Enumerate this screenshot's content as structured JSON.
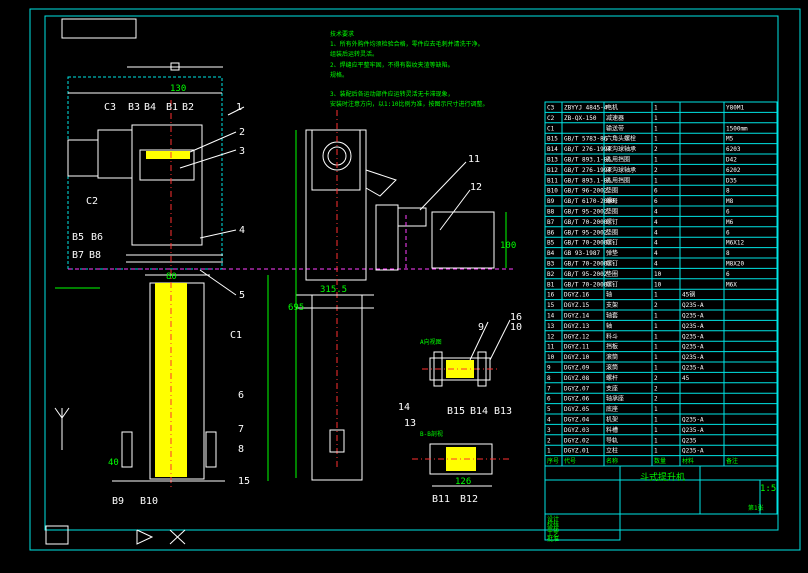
{
  "drawing": {
    "callouts_right": [
      "1",
      "2",
      "3",
      "4",
      "5"
    ],
    "callouts_c": [
      "C3",
      "B3",
      "B4",
      "B1",
      "B2",
      "C2",
      "B5",
      "B6",
      "B7",
      "B8",
      "C1"
    ],
    "callouts_bottom_left": [
      "6",
      "7",
      "8",
      "15",
      "B9",
      "B10"
    ],
    "callouts_mid": [
      "11",
      "12"
    ],
    "callouts_detail": [
      "16",
      "9",
      "10",
      "14",
      "B15",
      "B14",
      "B13",
      "13",
      "B11",
      "B12"
    ],
    "dims": {
      "d130": "130",
      "d80": "80",
      "d40": "40",
      "d100": "100",
      "d315": "315.5",
      "d126": "126",
      "d695": "695"
    },
    "colors": {
      "bg": "#000000",
      "frame": "#00e5e5",
      "line": "#ffffff",
      "text": "#00ff00",
      "center": "#ff3030",
      "fill": "#ffff00",
      "hidden": "#ff40ff"
    }
  },
  "notes": {
    "title": "技术要求",
    "lines": [
      "1、所有外购件均须检验合格，零件应去毛刺并清洗干净。",
      "组装后运转灵活。",
      "2、焊缝应平整牢固，不得有裂纹夹渣等缺陷。",
      "规格。",
      "3、装配后各运动部件应运转灵活无卡滞现象，",
      "安装时注意方向，以1:10比例为准，按图示尺寸进行调整。"
    ]
  },
  "bom": {
    "rows": [
      {
        "no": "C3",
        "code": "ZBYYJ 4845-4",
        "name": "电机",
        "qty": "1",
        "mat": "",
        "note": "Y80M1"
      },
      {
        "no": "C2",
        "code": "ZB-QX-150",
        "name": "减速器",
        "qty": "1",
        "mat": "",
        "note": ""
      },
      {
        "no": "C1",
        "code": "",
        "name": "输送带",
        "qty": "1",
        "mat": "",
        "note": "1500mm"
      },
      {
        "no": "B15",
        "code": "GB/T 5783-86",
        "name": "六角头螺栓",
        "qty": "1",
        "mat": "",
        "note": "M5"
      },
      {
        "no": "B14",
        "code": "GB/T 276-1994",
        "name": "深沟球轴承",
        "qty": "2",
        "mat": "",
        "note": "6203"
      },
      {
        "no": "B13",
        "code": "GB/T 893.1-86",
        "name": "孔用挡圈",
        "qty": "1",
        "mat": "",
        "note": "D42"
      },
      {
        "no": "B12",
        "code": "GB/T 276-1994",
        "name": "深沟球轴承",
        "qty": "2",
        "mat": "",
        "note": "6202"
      },
      {
        "no": "B11",
        "code": "GB/T 893.1-86",
        "name": "孔用挡圈",
        "qty": "1",
        "mat": "",
        "note": "D35"
      },
      {
        "no": "B10",
        "code": "GB/T 96-2002",
        "name": "垫圈",
        "qty": "6",
        "mat": "",
        "note": "8"
      },
      {
        "no": "B9",
        "code": "GB/T 6170-2000",
        "name": "螺母",
        "qty": "6",
        "mat": "",
        "note": "M8"
      },
      {
        "no": "B8",
        "code": "GB/T 95-2002",
        "name": "垫圈",
        "qty": "4",
        "mat": "",
        "note": "6"
      },
      {
        "no": "B7",
        "code": "GB/T 70-2000",
        "name": "螺钉",
        "qty": "4",
        "mat": "",
        "note": "M6"
      },
      {
        "no": "B6",
        "code": "GB/T 95-2002",
        "name": "垫圈",
        "qty": "4",
        "mat": "",
        "note": "6"
      },
      {
        "no": "B5",
        "code": "GB/T 70-2000",
        "name": "螺钉",
        "qty": "4",
        "mat": "",
        "note": "M6X12"
      },
      {
        "no": "B4",
        "code": "GB 93-1987",
        "name": "弹垫",
        "qty": "4",
        "mat": "",
        "note": "8"
      },
      {
        "no": "B3",
        "code": "GB/T 70-2000",
        "name": "螺钉",
        "qty": "4",
        "mat": "",
        "note": "M8X20"
      },
      {
        "no": "B2",
        "code": "GB/T 95-2002",
        "name": "垫圈",
        "qty": "10",
        "mat": "",
        "note": "6"
      },
      {
        "no": "B1",
        "code": "GB/T 70-2000",
        "name": "螺钉",
        "qty": "10",
        "mat": "",
        "note": "M6X"
      },
      {
        "no": "16",
        "code": "DGYZ.16",
        "name": "轴",
        "qty": "1",
        "mat": "45钢",
        "note": ""
      },
      {
        "no": "15",
        "code": "DGYZ.15",
        "name": "支架",
        "qty": "2",
        "mat": "Q235-A",
        "note": ""
      },
      {
        "no": "14",
        "code": "DGYZ.14",
        "name": "轴套",
        "qty": "1",
        "mat": "Q235-A",
        "note": ""
      },
      {
        "no": "13",
        "code": "DGYZ.13",
        "name": "轴",
        "qty": "1",
        "mat": "Q235-A",
        "note": ""
      },
      {
        "no": "12",
        "code": "DGYZ.12",
        "name": "料斗",
        "qty": "1",
        "mat": "Q235-A",
        "note": ""
      },
      {
        "no": "11",
        "code": "DGYZ.11",
        "name": "挡板",
        "qty": "1",
        "mat": "Q235-A",
        "note": ""
      },
      {
        "no": "10",
        "code": "DGYZ.10",
        "name": "滚筒",
        "qty": "1",
        "mat": "Q235-A",
        "note": ""
      },
      {
        "no": "9",
        "code": "DGYZ.09",
        "name": "滚筒",
        "qty": "1",
        "mat": "Q235-A",
        "note": ""
      },
      {
        "no": "8",
        "code": "DGYZ.08",
        "name": "螺杆",
        "qty": "2",
        "mat": "45",
        "note": ""
      },
      {
        "no": "7",
        "code": "DGYZ.07",
        "name": "支座",
        "qty": "2",
        "mat": "",
        "note": ""
      },
      {
        "no": "6",
        "code": "DGYZ.06",
        "name": "轴承座",
        "qty": "2",
        "mat": "",
        "note": ""
      },
      {
        "no": "5",
        "code": "DGYZ.05",
        "name": "底座",
        "qty": "1",
        "mat": "",
        "note": ""
      },
      {
        "no": "4",
        "code": "DGYZ.04",
        "name": "机架",
        "qty": "1",
        "mat": "Q235-A",
        "note": ""
      },
      {
        "no": "3",
        "code": "DGYZ.03",
        "name": "料槽",
        "qty": "1",
        "mat": "Q235-A",
        "note": ""
      },
      {
        "no": "2",
        "code": "DGYZ.02",
        "name": "导轨",
        "qty": "1",
        "mat": "Q235",
        "note": ""
      },
      {
        "no": "1",
        "code": "DGYZ.01",
        "name": "立柱",
        "qty": "1",
        "mat": "Q235-A",
        "note": ""
      }
    ],
    "header": {
      "no": "序号",
      "code": "代号",
      "name": "名称",
      "qty": "数量",
      "mat": "材料",
      "note": "备注"
    }
  },
  "title_block": {
    "drawing_name": "斗式提升机",
    "scale": "1:5",
    "sheet": "第1张",
    "company": "",
    "sig_rows": [
      "设计",
      "校核",
      "审核",
      "工艺",
      "批准"
    ]
  },
  "section_labels": {
    "a": "A向视图",
    "b": "B-B剖视"
  }
}
